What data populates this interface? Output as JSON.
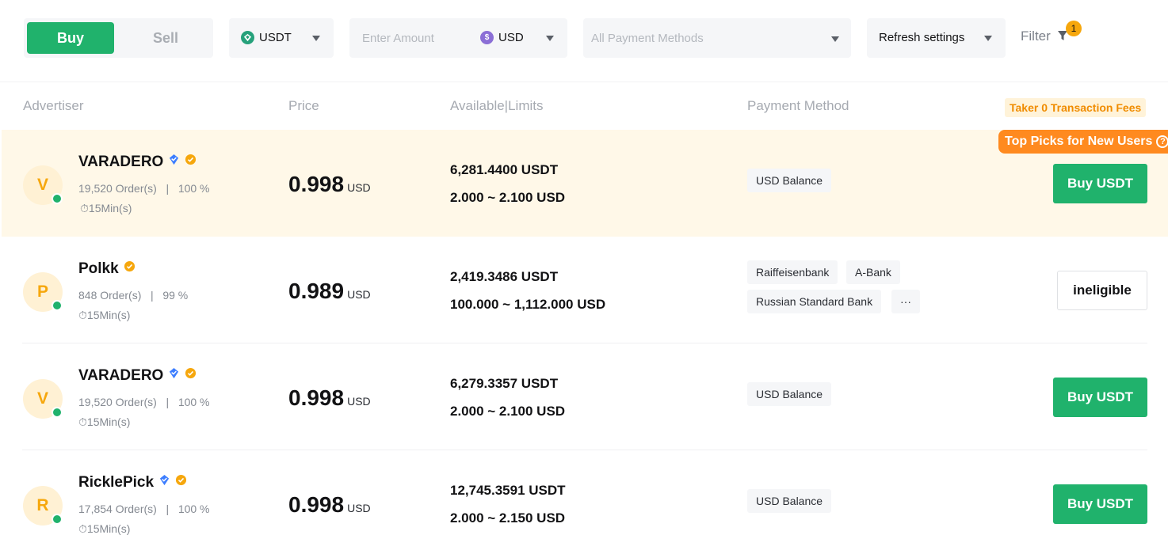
{
  "toolbar": {
    "buy_tab": "Buy",
    "sell_tab": "Sell",
    "crypto": "USDT",
    "amount_placeholder": "Enter Amount",
    "fiat": "USD",
    "payment_placeholder": "All Payment Methods",
    "refresh": "Refresh settings",
    "filter": "Filter",
    "filter_count": "1"
  },
  "header": {
    "advertiser": "Advertiser",
    "price": "Price",
    "available": "Available|Limits",
    "payment": "Payment Method",
    "fees": "Taker 0 Transaction Fees"
  },
  "top_pick_label": "Top Picks for New Users",
  "colors": {
    "accent": "#20b26c",
    "gold": "#f6a70d",
    "verified": "#3d7eff",
    "toppick": "#ff8a1f"
  },
  "rows": [
    {
      "initial": "V",
      "name": "VARADERO",
      "orders": "19,520 Order(s)",
      "sep": "|",
      "completion": "100 %",
      "time": "15Min(s)",
      "price": "0.998",
      "price_unit": "USD",
      "available": "6,281.4400 USDT",
      "limit": "2.000 ~ 2.100 USD",
      "methods": [
        "USD Balance"
      ],
      "action": "Buy USDT"
    },
    {
      "initial": "P",
      "name": "Polkk",
      "orders": "848 Order(s)",
      "sep": "|",
      "completion": "99 %",
      "time": "15Min(s)",
      "price": "0.989",
      "price_unit": "USD",
      "available": "2,419.3486 USDT",
      "limit": "100.000 ~ 1,112.000 USD",
      "methods": [
        "Raiffeisenbank",
        "A-Bank",
        "Russian Standard Bank",
        "···"
      ],
      "action": "ineligible"
    },
    {
      "initial": "V",
      "name": "VARADERO",
      "orders": "19,520 Order(s)",
      "sep": "|",
      "completion": "100 %",
      "time": "15Min(s)",
      "price": "0.998",
      "price_unit": "USD",
      "available": "6,279.3357 USDT",
      "limit": "2.000 ~ 2.100 USD",
      "methods": [
        "USD Balance"
      ],
      "action": "Buy USDT"
    },
    {
      "initial": "R",
      "name": "RicklePick",
      "orders": "17,854 Order(s)",
      "sep": "|",
      "completion": "100 %",
      "time": "15Min(s)",
      "price": "0.998",
      "price_unit": "USD",
      "available": "12,745.3591 USDT",
      "limit": "2.000 ~ 2.150 USD",
      "methods": [
        "USD Balance"
      ],
      "action": "Buy USDT"
    }
  ]
}
